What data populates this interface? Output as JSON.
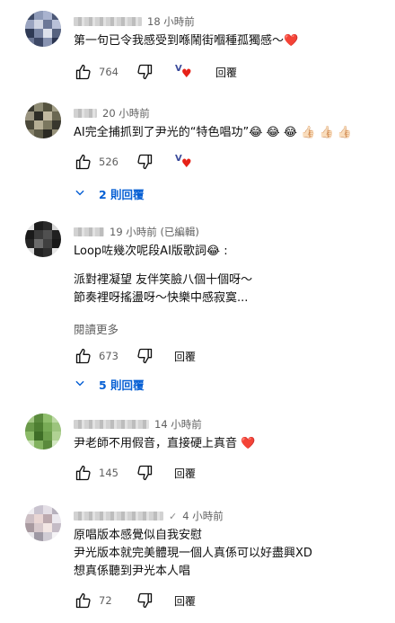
{
  "comments": [
    {
      "time": "18 小時前",
      "lines": [
        "第一句已令我感受到喺鬧街嗰種孤獨感～❤️"
      ],
      "likes": "764",
      "reply_label": "回覆"
    },
    {
      "time": "20 小時前",
      "lines": [
        "AI完全捕抓到了尹光的“特色唱功”😂 😂 😂 👍🏻 👍🏻 👍🏻"
      ],
      "likes": "526",
      "reply_label": "回覆",
      "replies_label": "2 則回覆"
    },
    {
      "time": "19 小時前 (已編輯)",
      "lines": [
        "Loop咗幾次呢段AI版歌詞😂 :",
        "",
        "派對裡凝望 友伴笑臉八個十個呀～",
        "節奏裡呀搖盪呀～快樂中感寂寞..."
      ],
      "read_more": "閱讀更多",
      "likes": "673",
      "reply_label": "回覆",
      "replies_label": "5 則回覆"
    },
    {
      "time": "14 小時前",
      "lines": [
        "尹老師不用假音，直接硬上真音 ❤️"
      ],
      "likes": "145",
      "reply_label": "回覆"
    },
    {
      "time": "4 小時前",
      "check": "✓",
      "lines": [
        "原唱版本感覺似自我安慰",
        "尹光版本就完美體現一個人真係可以好盡興XD",
        "想真係聽到尹光本人唱"
      ],
      "likes": "72",
      "reply_label": "回覆"
    }
  ],
  "icons": {
    "like": "thumbs-up-icon",
    "dislike": "thumbs-down-icon",
    "hearted": "creator-heart-icon",
    "replies": "chevron-down-icon"
  },
  "colors": {
    "link_blue": "#065fd4",
    "heart_red": "#e62117",
    "meta_gray": "#606060"
  }
}
